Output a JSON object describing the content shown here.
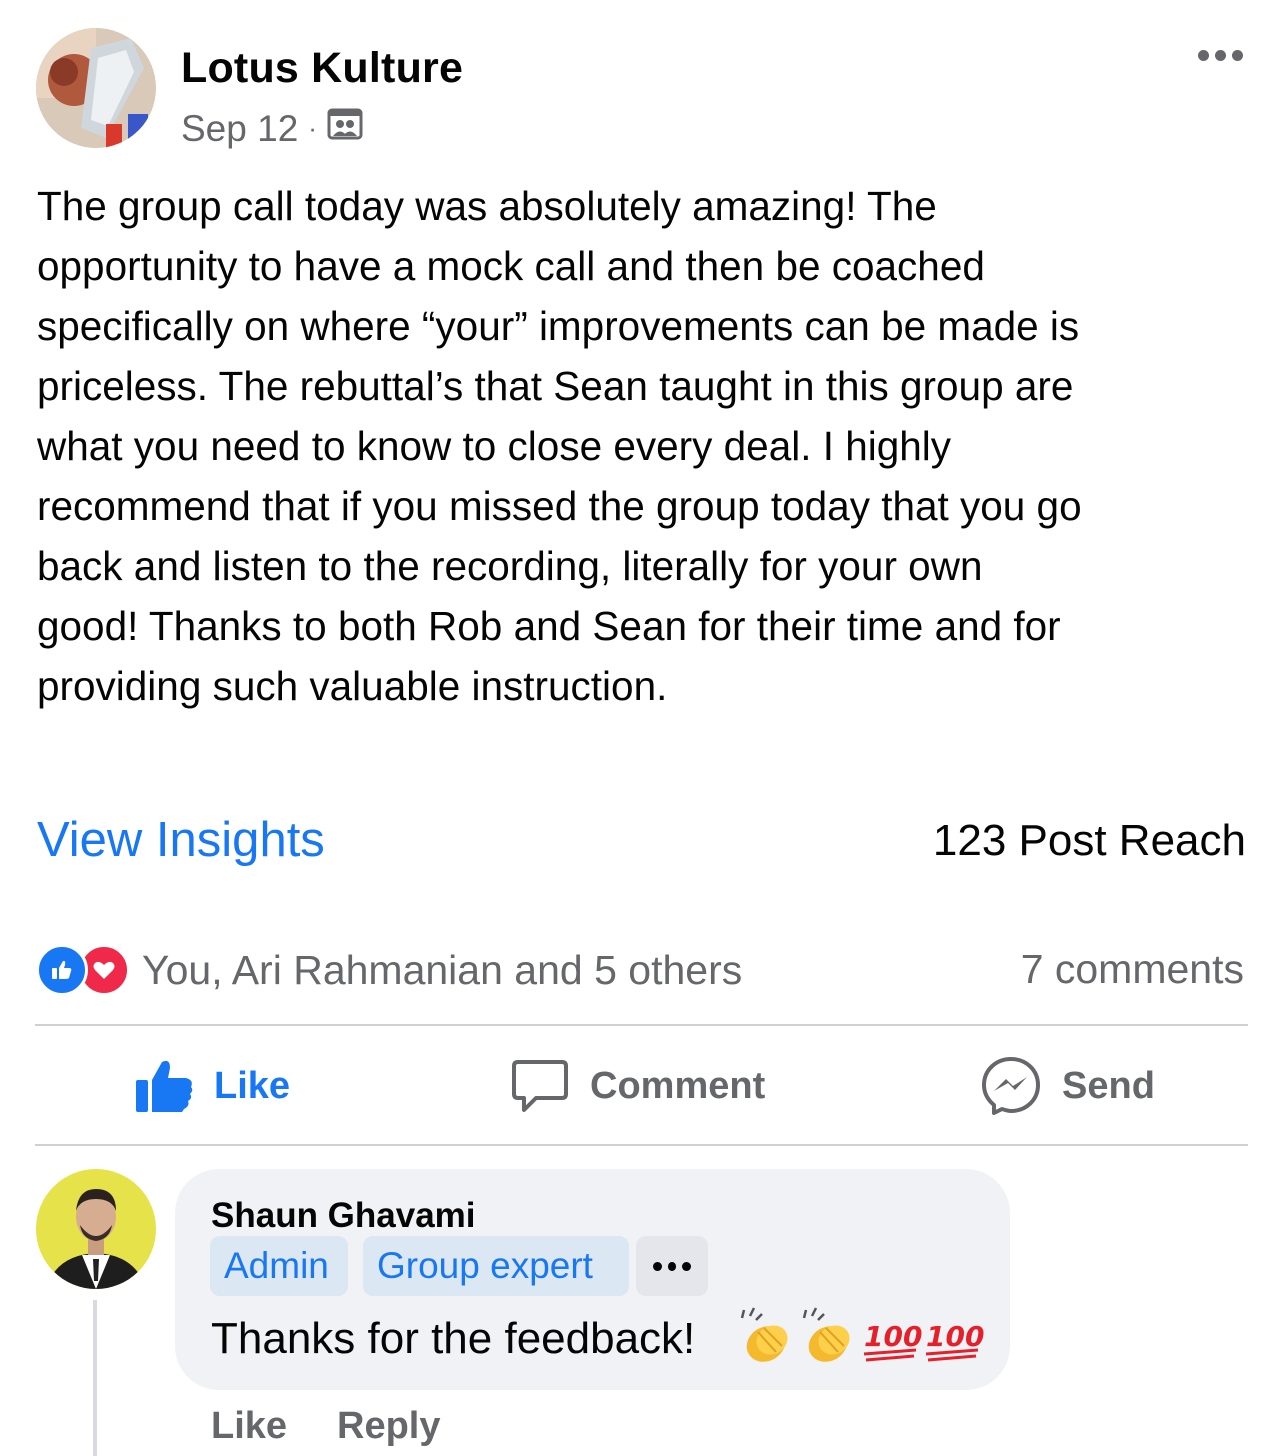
{
  "post": {
    "author": "Lotus Kulture",
    "date": "Sep 12",
    "separator": "·",
    "audience_icon": "group-audience-icon",
    "more_icon": "more-options-icon",
    "text": "The group call today was absolutely amazing! The\nopportunity to have a mock call and then be coached\nspecifically on where “your” improvements can be made is\npriceless. The rebuttal’s that Sean taught in this group are\nwhat you need to know to close every deal. I highly\nrecommend that if you missed the group today that you go\nback and listen to the recording, literally for your own\ngood! Thanks to both Rob and Sean for their time and for\nproviding such valuable instruction."
  },
  "insights": {
    "view_label": "View Insights",
    "reach": "123 Post Reach"
  },
  "reactions": {
    "icons": [
      "like-icon",
      "love-icon"
    ],
    "names": "You, Ari Rahmanian and 5 others",
    "comments": "7 comments"
  },
  "actions": {
    "like": "Like",
    "comment": "Comment",
    "send": "Send"
  },
  "comment": {
    "author": "Shaun Ghavami",
    "badges": [
      "Admin",
      "Group expert"
    ],
    "text": "Thanks for the feedback!",
    "emojis": [
      "clapping-hands-emoji",
      "clapping-hands-emoji",
      "hundred-points-emoji",
      "hundred-points-emoji"
    ],
    "like_label": "Like",
    "reply_label": "Reply"
  },
  "colors": {
    "accent": "#1877f2",
    "love": "#f02849",
    "secondary_text": "#65676b",
    "bubble": "#f0f2f5",
    "badge_bg": "#dbe7f2"
  }
}
